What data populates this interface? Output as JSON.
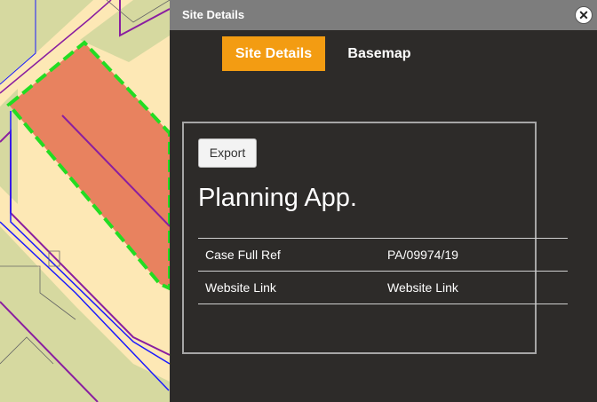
{
  "panel": {
    "title": "Site Details",
    "close_icon": "close-icon"
  },
  "tabs": [
    {
      "label": "Site Details",
      "active": true
    },
    {
      "label": "Basemap",
      "active": false
    }
  ],
  "content": {
    "export_label": "Export",
    "heading": "Planning App.",
    "rows": [
      {
        "key": "Case Full Ref",
        "value": "PA/09974/19"
      },
      {
        "key": "Website Link",
        "value": "Website Link"
      }
    ]
  },
  "colors": {
    "accent_tab": "#f39c12",
    "panel_bg": "#2d2b29",
    "header_bg": "#7d7d7d",
    "site_fill": "#e8825f",
    "site_outline": "#22dd22",
    "parcel_fill": "#fde8b5",
    "building_fill": "#d6d9a0",
    "boundary_purple": "#8a1ea0",
    "boundary_blue": "#1a1aff"
  }
}
